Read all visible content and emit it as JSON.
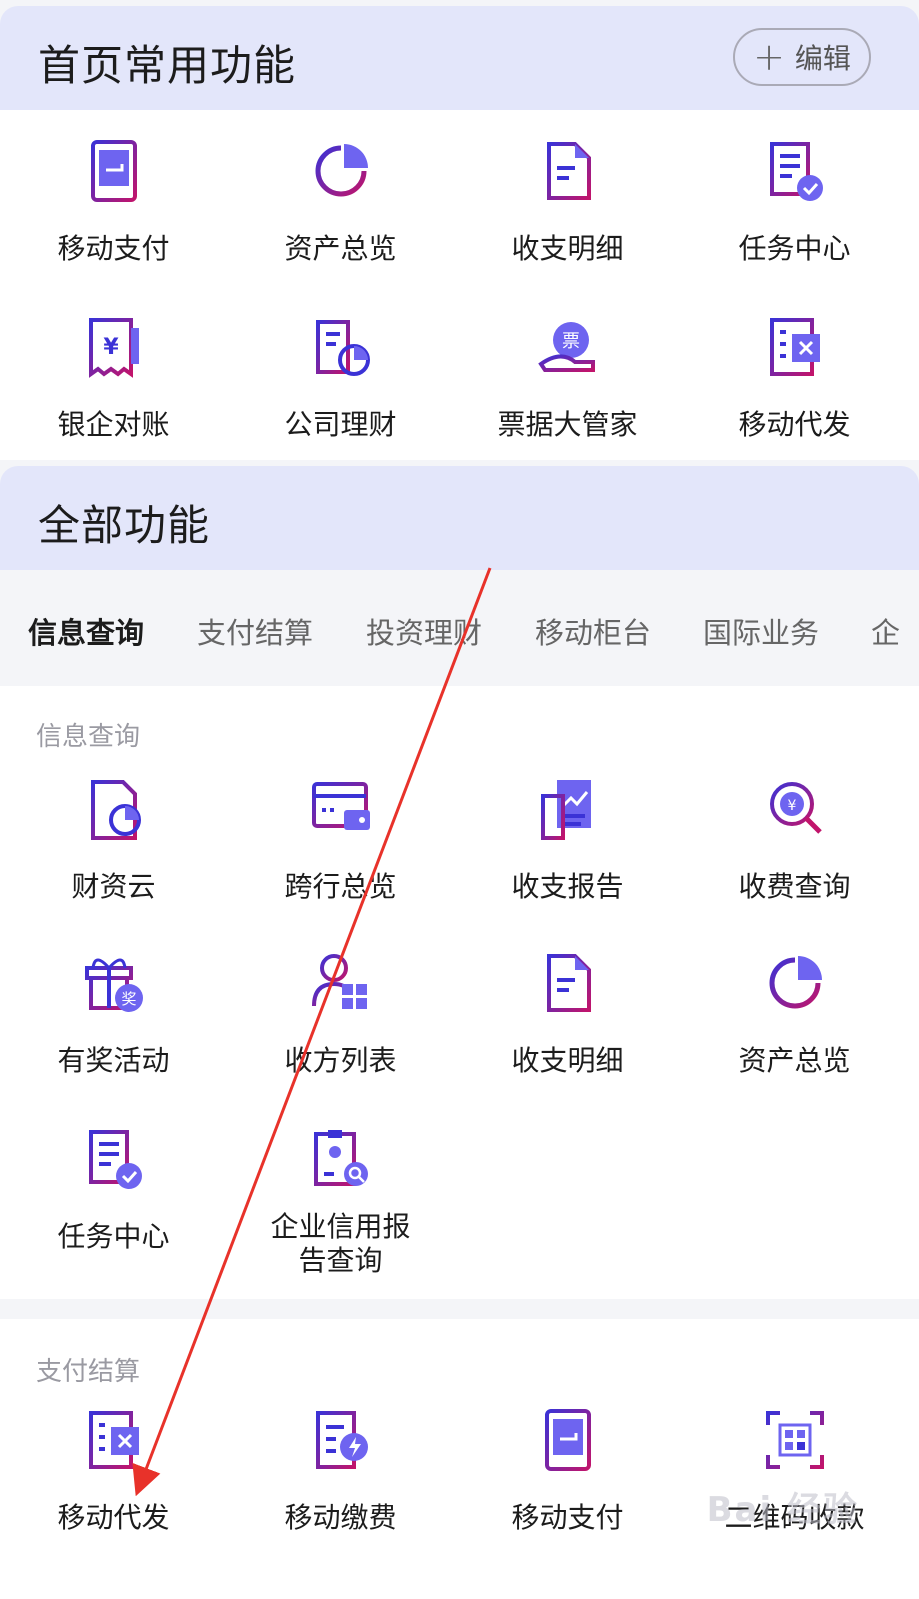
{
  "favorites": {
    "title": "首页常用功能",
    "edit_label": "编辑",
    "items": [
      {
        "label": "移动支付",
        "icon": "phone-pay-icon"
      },
      {
        "label": "资产总览",
        "icon": "pie-chart-icon"
      },
      {
        "label": "收支明细",
        "icon": "document-icon"
      },
      {
        "label": "任务中心",
        "icon": "task-check-icon"
      },
      {
        "label": "银企对账",
        "icon": "receipt-yuan-icon"
      },
      {
        "label": "公司理财",
        "icon": "building-chart-icon"
      },
      {
        "label": "票据大管家",
        "icon": "hand-ticket-icon"
      },
      {
        "label": "移动代发",
        "icon": "excel-sheet-icon"
      }
    ]
  },
  "all": {
    "title": "全部功能",
    "tabs": [
      "信息查询",
      "支付结算",
      "投资理财",
      "移动柜台",
      "国际业务",
      "企"
    ],
    "active_tab": 0,
    "sections": [
      {
        "label": "信息查询",
        "items": [
          {
            "label": "财资云",
            "icon": "cloud-finance-icon"
          },
          {
            "label": "跨行总览",
            "icon": "wallet-card-icon"
          },
          {
            "label": "收支报告",
            "icon": "report-trend-icon"
          },
          {
            "label": "收费查询",
            "icon": "search-yuan-icon"
          },
          {
            "label": "有奖活动",
            "icon": "gift-prize-icon"
          },
          {
            "label": "收方列表",
            "icon": "payee-list-icon"
          },
          {
            "label": "收支明细",
            "icon": "document-icon"
          },
          {
            "label": "资产总览",
            "icon": "pie-chart-icon"
          },
          {
            "label": "任务中心",
            "icon": "task-check-icon"
          },
          {
            "label": "企业信用报告查询",
            "icon": "credit-report-icon"
          }
        ]
      },
      {
        "label": "支付结算",
        "items": [
          {
            "label": "移动代发",
            "icon": "excel-sheet-icon"
          },
          {
            "label": "移动缴费",
            "icon": "bill-lightning-icon"
          },
          {
            "label": "移动支付",
            "icon": "phone-pay-icon"
          },
          {
            "label": "二维码收款",
            "icon": "qr-code-icon"
          }
        ]
      }
    ]
  },
  "icon_glyphs": {
    "prize": "奖",
    "ticket": "票",
    "yuan": "¥"
  },
  "watermark": "Bai 经验",
  "colors": {
    "primary": "#3b32d6",
    "accent": "#6e64f0",
    "secondary": "#c1146b",
    "header_bg": "#e3e6fa",
    "annotation": "#e8322a"
  }
}
